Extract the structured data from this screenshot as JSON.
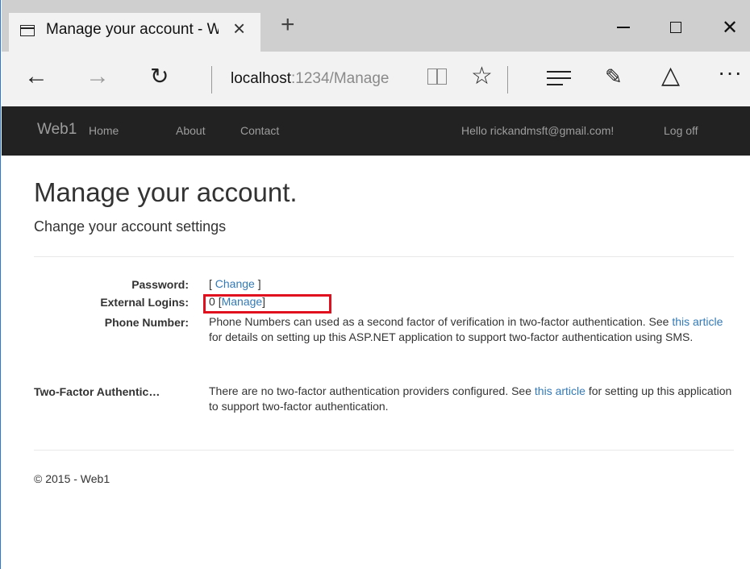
{
  "browser": {
    "tab_title": "Manage your account - Web1",
    "tab_close_icon": "close-icon",
    "new_tab_glyph": "+",
    "address_host": "localhost",
    "address_path": ":1234/Manage",
    "window_controls": [
      "minimize",
      "maximize",
      "close"
    ]
  },
  "site_nav": {
    "brand": "Web1",
    "links": [
      "Home",
      "About",
      "Contact"
    ],
    "hello": "Hello rickandmsft@gmail.com!",
    "logoff": "Log off"
  },
  "main": {
    "title": "Manage your account.",
    "subtitle": "Change your account settings",
    "password": {
      "label": "Password:",
      "open": "[ ",
      "link": "Change",
      "close": " ]"
    },
    "external_logins": {
      "label": "External Logins:",
      "count": "0 ",
      "open": "[",
      "link": "Manage",
      "close": "]"
    },
    "phone_number": {
      "label": "Phone Number:",
      "text_before": "Phone Numbers can used as a second factor of verification in two-factor authentication. See ",
      "link": "this article",
      "text_after": " for details on setting up this ASP.NET application to support two-factor authentication using SMS."
    },
    "two_factor": {
      "label": "Two-Factor Authentic…",
      "text_before": "There are no two-factor authentication providers configured. See ",
      "link": "this article",
      "text_after": " for setting up this application to support two-factor authentication."
    }
  },
  "footer": {
    "text": "© 2015 - Web1"
  },
  "colors": {
    "navbar_bg": "#222222",
    "link": "#337ab7",
    "highlight": "#e0101e"
  }
}
